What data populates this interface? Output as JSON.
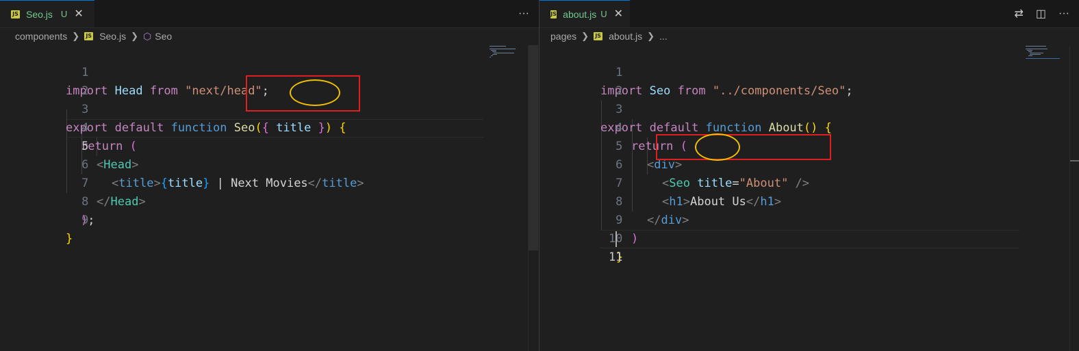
{
  "left": {
    "tab": {
      "filename": "Seo.js",
      "status": "U",
      "close": "✕",
      "badge": "JS"
    },
    "actions": {
      "more": "···"
    },
    "breadcrumb": {
      "folder": "components",
      "file": "Seo.js",
      "symbol": "Seo",
      "badge": "JS"
    },
    "line_numbers": [
      "1",
      "2",
      "3",
      "4",
      "5",
      "6",
      "7",
      "8",
      "9"
    ],
    "code": {
      "l1": {
        "kw1": "import",
        "id": "Head",
        "kw2": "from",
        "str": "\"next/head\"",
        "semi": ";"
      },
      "l3": {
        "kw1": "export",
        "kw2": "default",
        "kw3": "function",
        "name": "Seo",
        "p1": "(",
        "b1": "{",
        "param": "title",
        "b2": "}",
        "p2": ")",
        "b3": "{"
      },
      "l4": {
        "kw": "return",
        "p": "("
      },
      "l5": {
        "lt": "<",
        "tag": "Head",
        "gt": ">"
      },
      "l6": {
        "lt1": "<",
        "tag1": "title",
        "gt1": ">",
        "b1": "{",
        "expr": "title",
        "b2": "}",
        "text": " | Next Movies",
        "lt2": "</",
        "tag2": "title",
        "gt2": ">"
      },
      "l7": {
        "lt": "</",
        "tag": "Head",
        "gt": ">"
      },
      "l8": {
        "p": ")",
        "semi": ";"
      },
      "l9": {
        "b": "}"
      }
    }
  },
  "right": {
    "tab": {
      "filename": "about.js",
      "status": "U",
      "close": "✕",
      "badge": "JS"
    },
    "actions": {
      "compare": "⇄",
      "split": "◫",
      "more": "···"
    },
    "breadcrumb": {
      "folder": "pages",
      "file": "about.js",
      "symbol": "...",
      "badge": "JS"
    },
    "line_numbers": [
      "1",
      "2",
      "3",
      "4",
      "5",
      "6",
      "7",
      "8",
      "9",
      "10",
      "11"
    ],
    "code": {
      "l1": {
        "kw1": "import",
        "id": "Seo",
        "kw2": "from",
        "str": "\"../components/Seo\"",
        "semi": ";"
      },
      "l3": {
        "kw1": "export",
        "kw2": "default",
        "kw3": "function",
        "name": "About",
        "parens": "()",
        "b": "{"
      },
      "l4": {
        "kw": "return",
        "p": "("
      },
      "l5": {
        "lt": "<",
        "tag": "div",
        "gt": ">"
      },
      "l6": {
        "lt": "<",
        "tag": "Seo",
        "attr": "title",
        "eq": "=",
        "val": "\"About\"",
        "close": "/>"
      },
      "l7": {
        "lt1": "<",
        "tag1": "h1",
        "gt1": ">",
        "text": "About Us",
        "lt2": "</",
        "tag2": "h1",
        "gt2": ">"
      },
      "l8": {
        "lt": "</",
        "tag": "div",
        "gt": ">"
      },
      "l9": {
        "p": ")"
      },
      "l10": {
        "b": "}"
      }
    }
  }
}
